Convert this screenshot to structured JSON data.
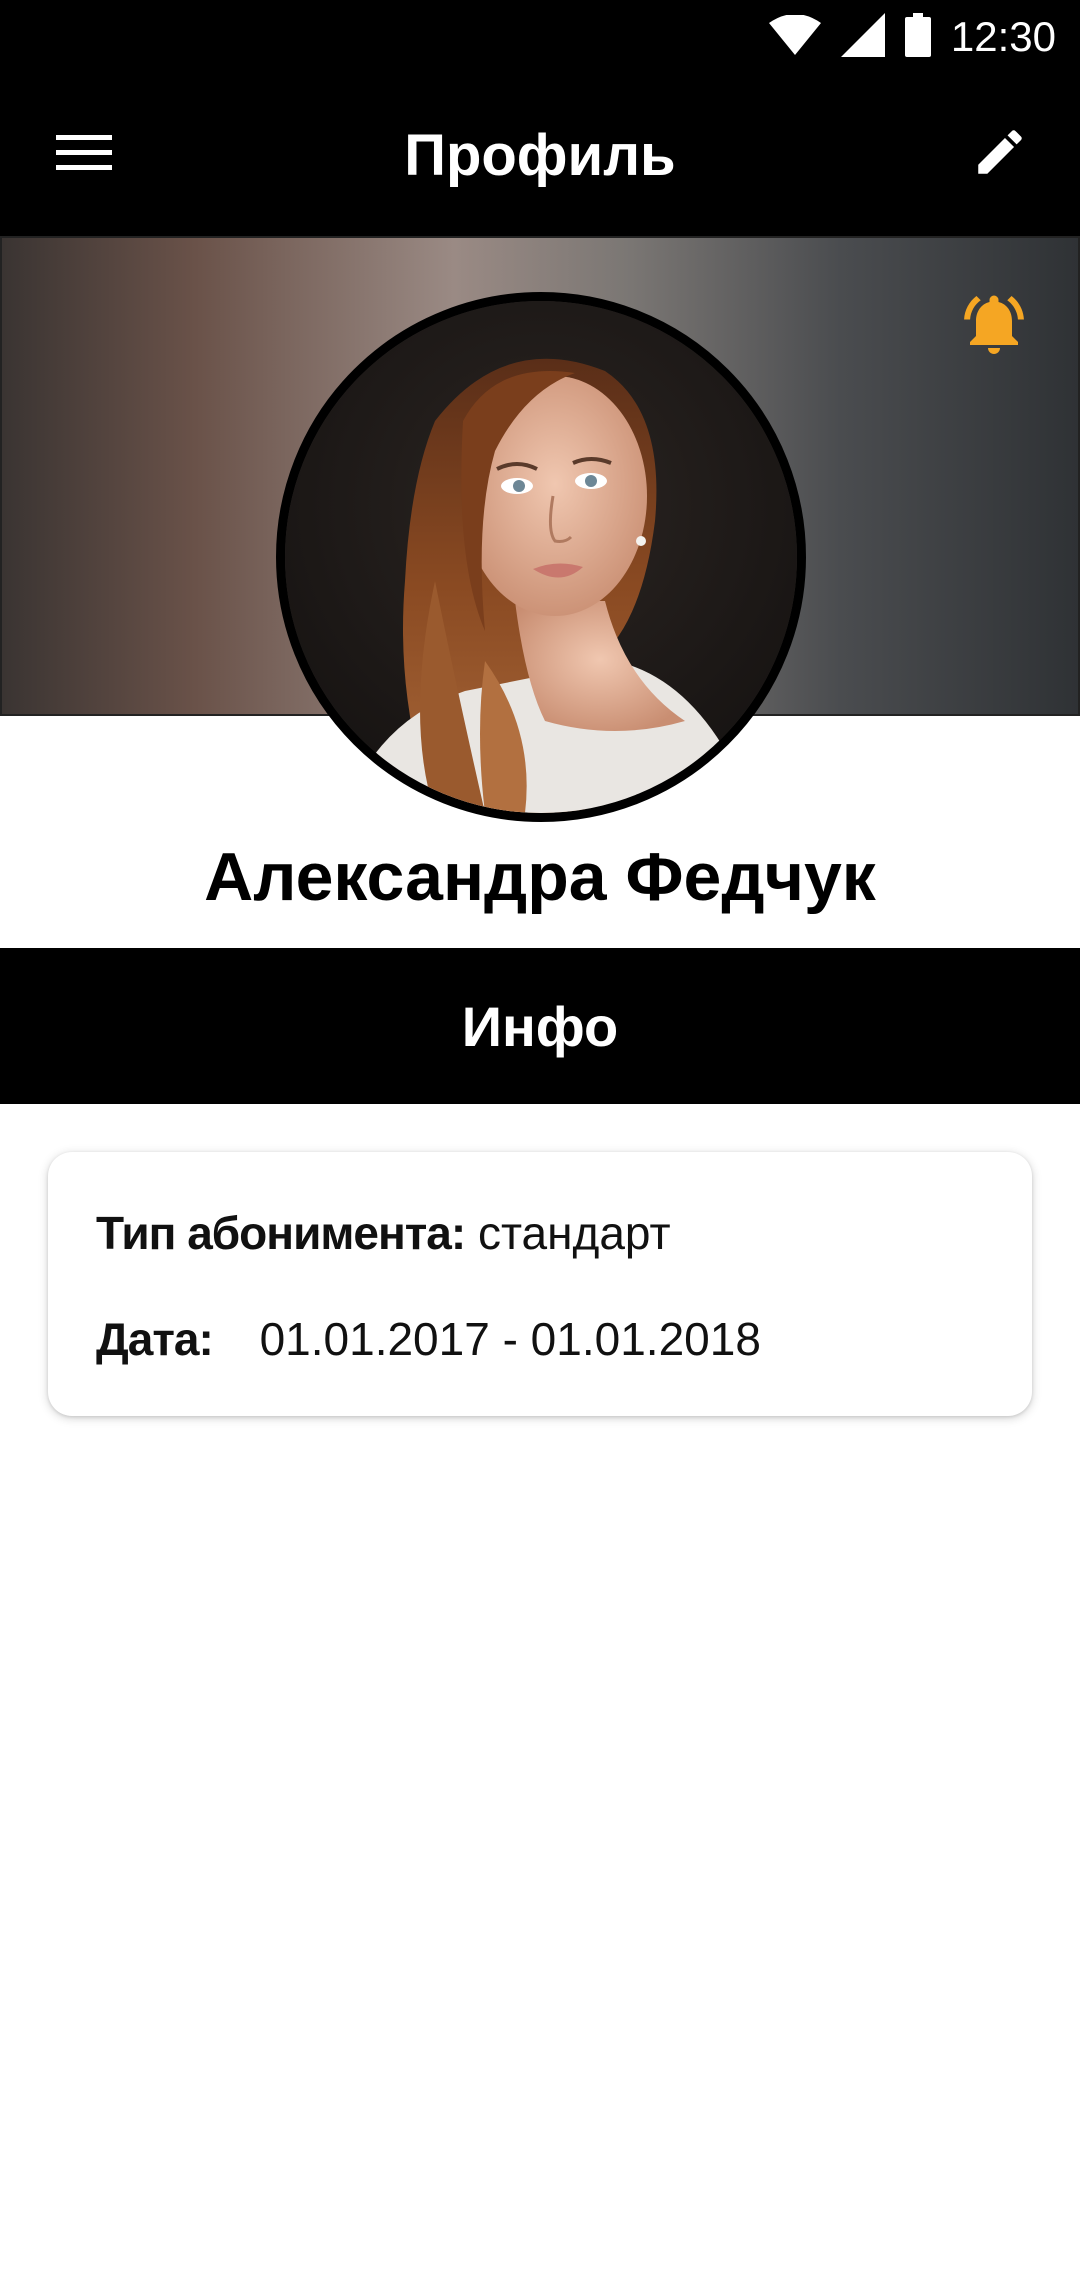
{
  "status_bar": {
    "time": "12:30",
    "icons": [
      "wifi-icon",
      "signal-icon",
      "battery-icon"
    ]
  },
  "app_bar": {
    "title": "Профиль",
    "left_icon": "menu-icon",
    "right_icon": "edit-icon"
  },
  "cover": {
    "notification_icon": "bell-icon",
    "notification_color": "#f5a623"
  },
  "profile": {
    "name": "Александра Федчук"
  },
  "section": {
    "title": "Инфо"
  },
  "info": {
    "subscription_label": "Тип абонимента:",
    "subscription_value": "стандарт",
    "date_label": "Дата:",
    "date_value": "01.01.2017 - 01.01.2018"
  }
}
